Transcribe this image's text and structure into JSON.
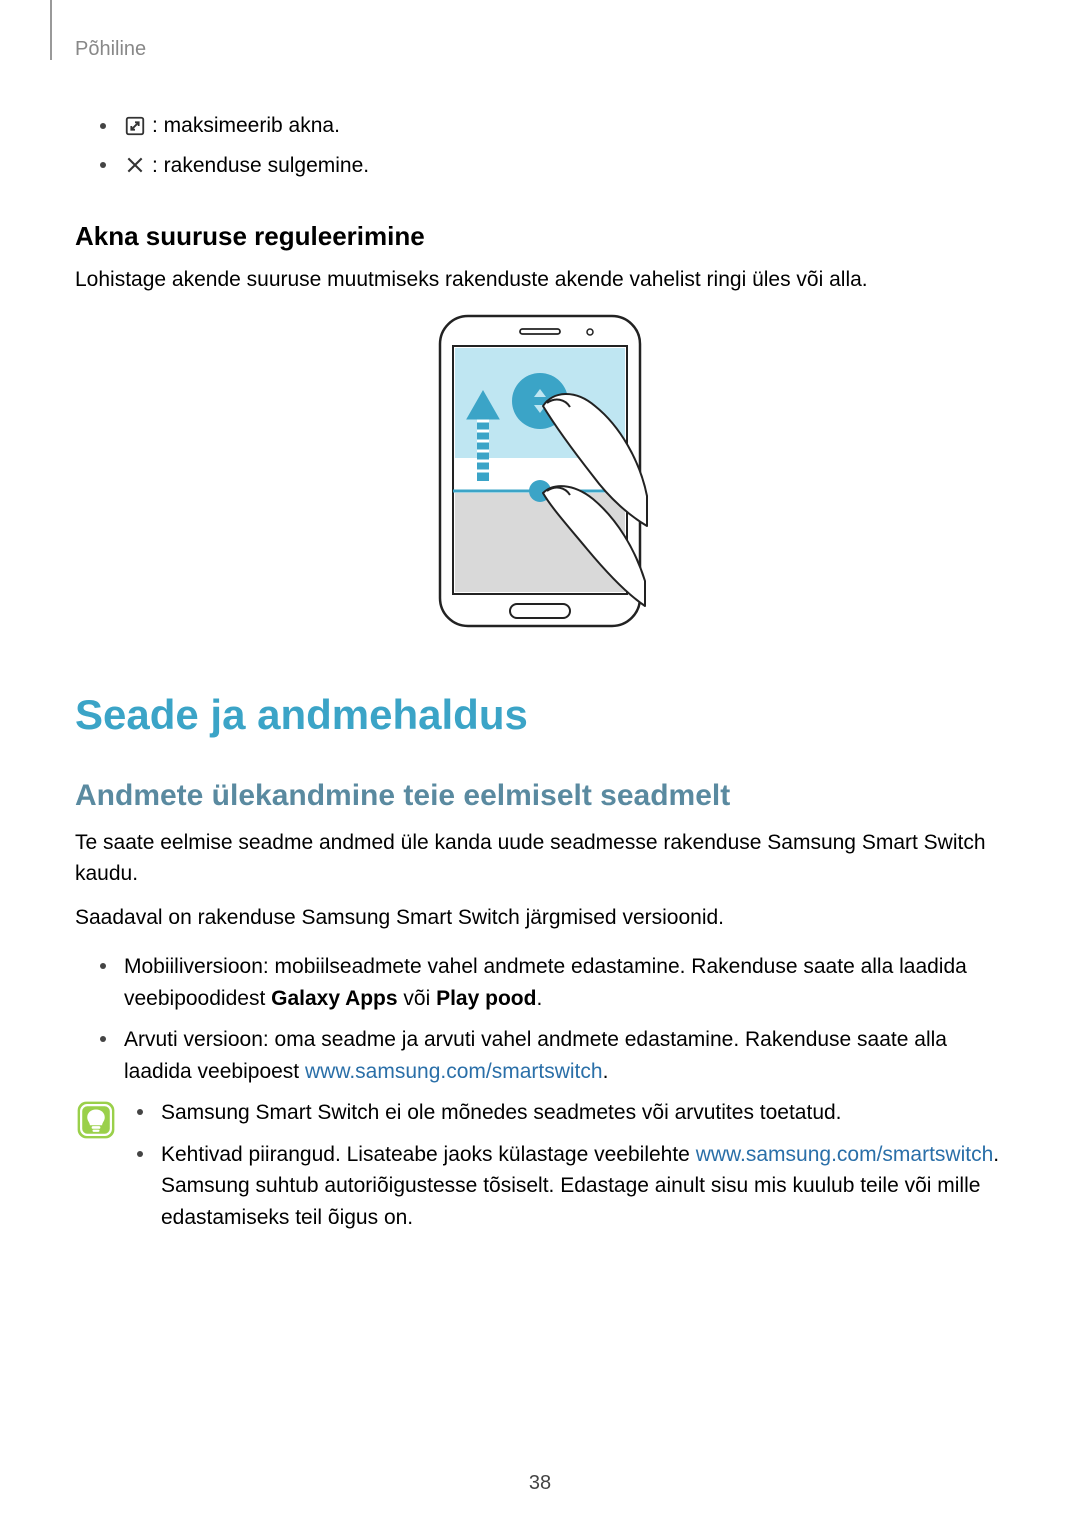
{
  "header": "Põhiline",
  "icon_bullets": [
    {
      "icon": "maximize-icon",
      "text": " : maksimeerib akna."
    },
    {
      "icon": "close-icon",
      "text": " : rakenduse sulgemine."
    }
  ],
  "section1": {
    "heading": "Akna suuruse reguleerimine",
    "body": "Lohistage akende suuruse muutmiseks rakenduste akende vahelist ringi üles või alla."
  },
  "main_heading": "Seade ja andmehaldus",
  "section2": {
    "heading": "Andmete ülekandmine teie eelmiselt seadmelt",
    "para1": "Te saate eelmise seadme andmed üle kanda uude seadmesse rakenduse Samsung Smart Switch kaudu.",
    "para2": "Saadaval on rakenduse Samsung Smart Switch järgmised versioonid.",
    "bullet1_pre": "Mobiiliversioon: mobiilseadmete vahel andmete edastamine. Rakenduse saate alla laadida veebipoodidest ",
    "bullet1_bold1": "Galaxy Apps",
    "bullet1_mid": " või ",
    "bullet1_bold2": "Play pood",
    "bullet1_post": ".",
    "bullet2_pre": "Arvuti versioon: oma seadme ja arvuti vahel andmete edastamine. Rakenduse saate alla laadida veebipoest ",
    "bullet2_link": "www.samsung.com/smartswitch",
    "bullet2_post": "."
  },
  "note": {
    "bullet1": "Samsung Smart Switch ei ole mõnedes seadmetes või arvutites toetatud.",
    "bullet2_pre": "Kehtivad piirangud. Lisateabe jaoks külastage veebilehte ",
    "bullet2_link": "www.samsung.com/smartswitch",
    "bullet2_post": ". Samsung suhtub autoriõigustesse tõsiselt. Edastage ainult sisu mis kuulub teile või mille edastamiseks teil õigus on."
  },
  "page_number": "38"
}
